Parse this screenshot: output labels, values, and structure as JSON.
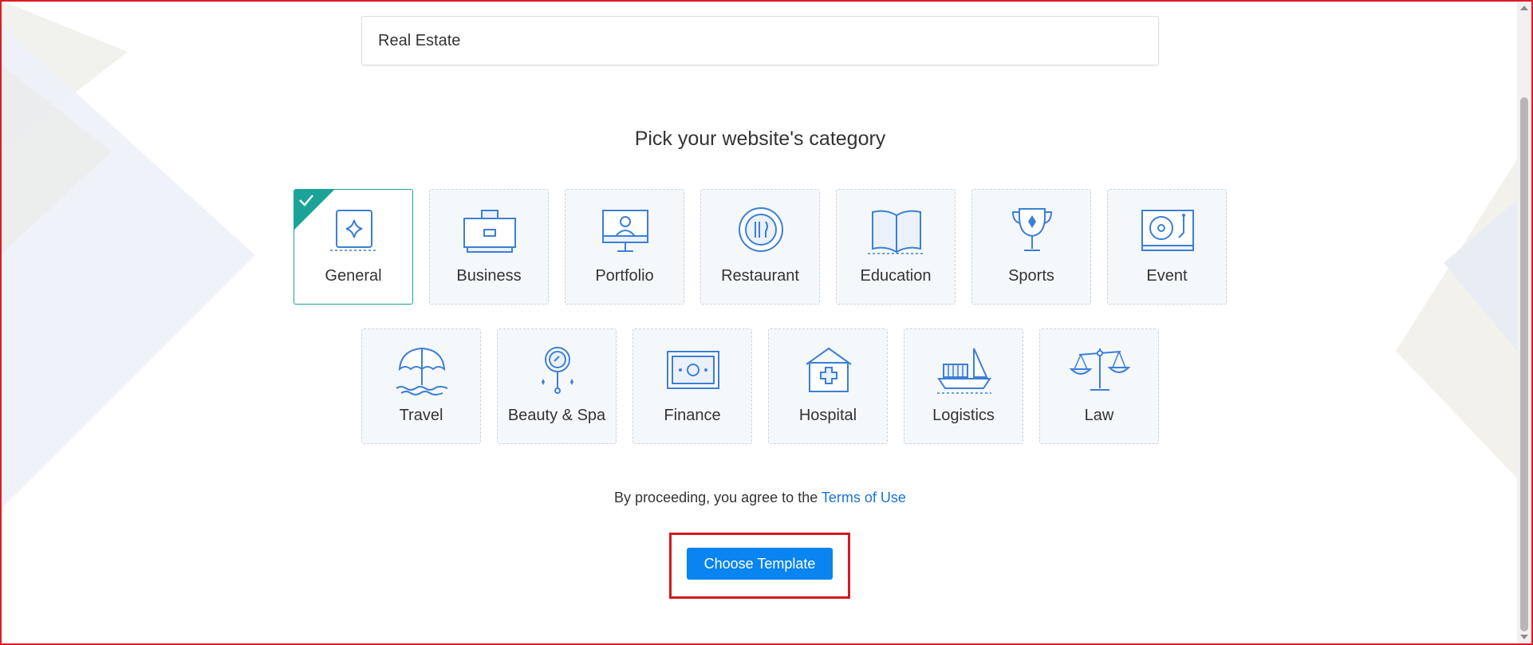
{
  "site_name_input": {
    "value": "Real Estate"
  },
  "heading": "Pick your website's category",
  "categories": [
    {
      "label": "General",
      "icon": "sparkle-frame-icon",
      "selected": true
    },
    {
      "label": "Business",
      "icon": "briefcase-icon",
      "selected": false
    },
    {
      "label": "Portfolio",
      "icon": "monitor-person-icon",
      "selected": false
    },
    {
      "label": "Restaurant",
      "icon": "plate-fork-icon",
      "selected": false
    },
    {
      "label": "Education",
      "icon": "open-book-icon",
      "selected": false
    },
    {
      "label": "Sports",
      "icon": "trophy-icon",
      "selected": false
    },
    {
      "label": "Event",
      "icon": "turntable-icon",
      "selected": false
    },
    {
      "label": "Travel",
      "icon": "beach-umbrella-icon",
      "selected": false
    },
    {
      "label": "Beauty & Spa",
      "icon": "hand-mirror-icon",
      "selected": false
    },
    {
      "label": "Finance",
      "icon": "banknote-icon",
      "selected": false
    },
    {
      "label": "Hospital",
      "icon": "hospital-icon",
      "selected": false
    },
    {
      "label": "Logistics",
      "icon": "cargo-ship-icon",
      "selected": false
    },
    {
      "label": "Law",
      "icon": "scales-icon",
      "selected": false
    }
  ],
  "agreement": {
    "text": "By proceeding, you agree to the",
    "link": "Terms of Use"
  },
  "choose_button": "Choose Template",
  "colors": {
    "accent": "#1aa396",
    "primary_button": "#0a84f0",
    "link": "#1a73d9",
    "icon": "#3c7fd6",
    "highlight": "#d7191f"
  }
}
